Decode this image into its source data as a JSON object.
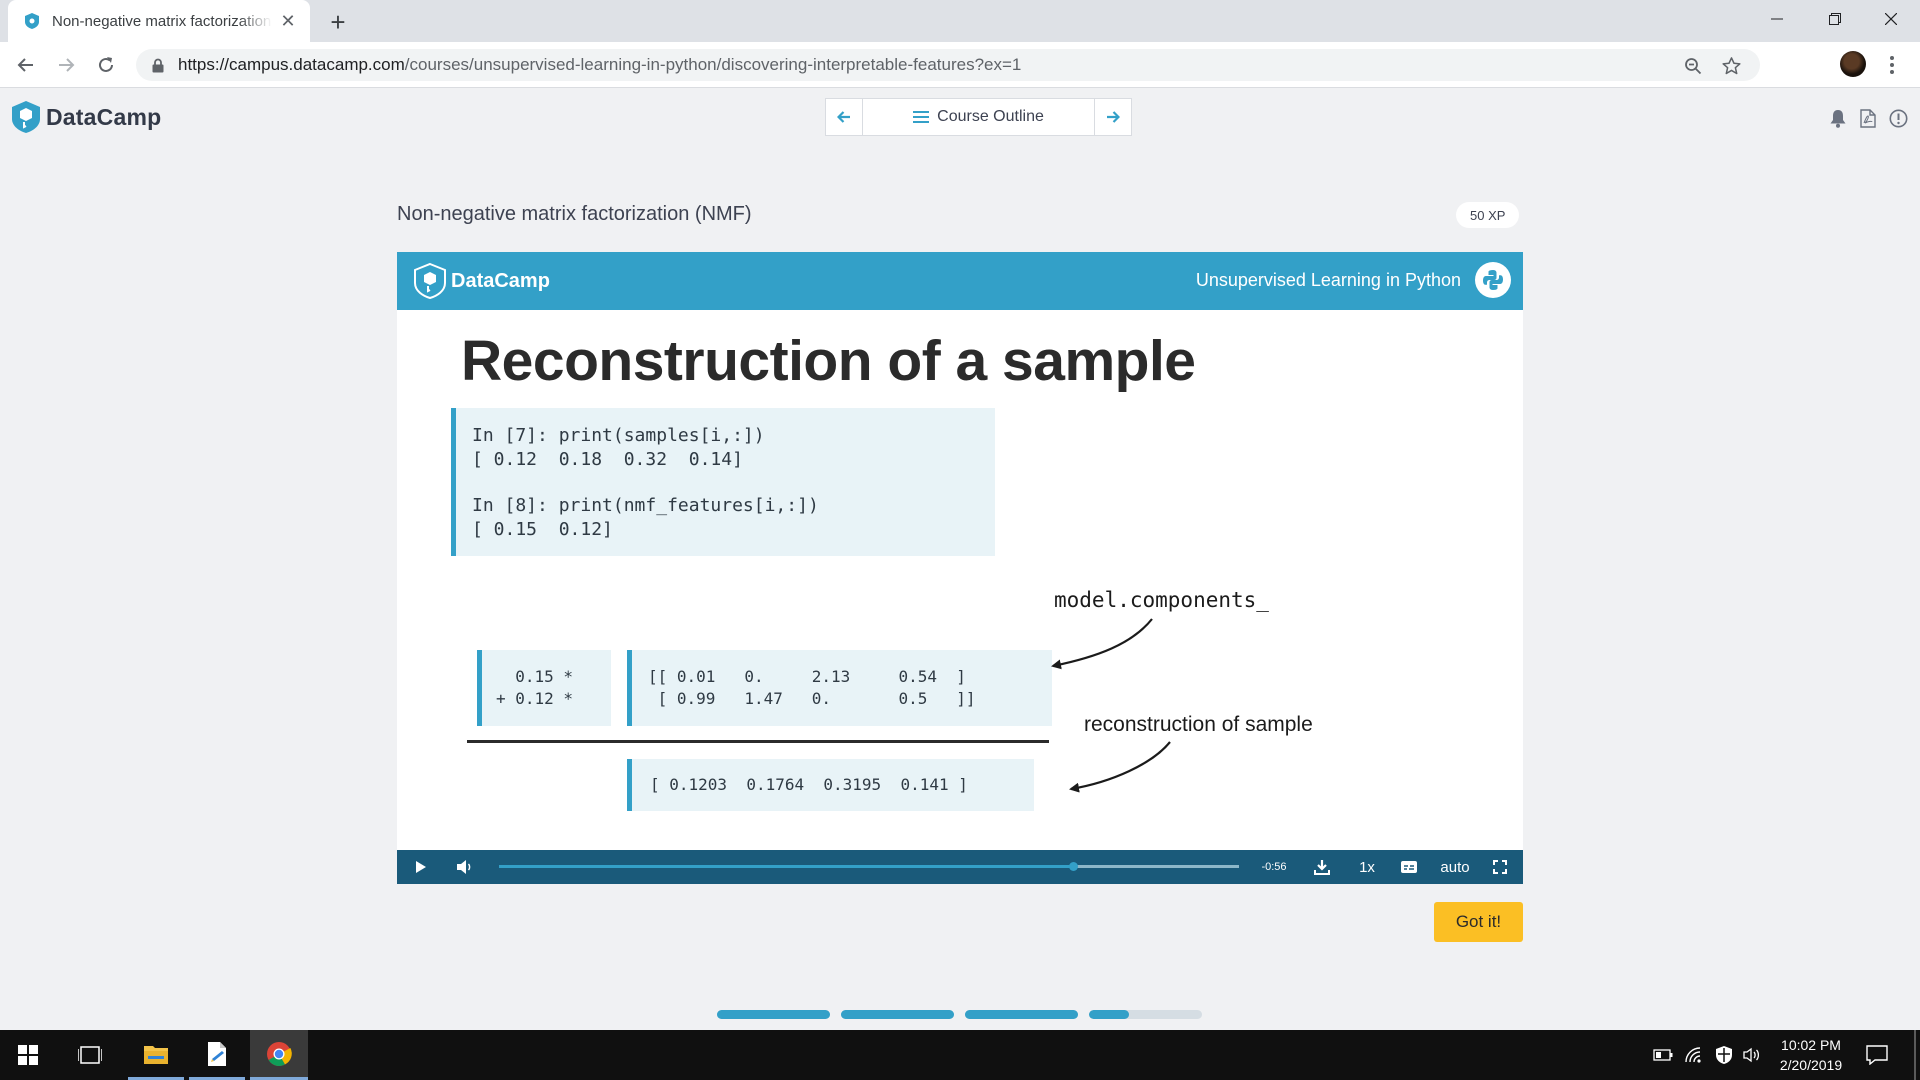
{
  "browser": {
    "tab_title": "Non-negative matrix factorization (NMF) | Python",
    "url_host": "https://campus.datacamp.com",
    "url_path": "/courses/unsupervised-learning-in-python/discovering-interpretable-features?ex=1"
  },
  "header": {
    "logo_text": "DataCamp",
    "course_outline_label": "Course Outline"
  },
  "exercise": {
    "title": "Non-negative matrix factorization (NMF)",
    "xp": "50 XP",
    "got_it_label": "Got it!"
  },
  "slide": {
    "logo_text": "DataCamp",
    "course_name": "Unsupervised Learning in Python",
    "heading": "Reconstruction of a sample",
    "code_lines": [
      "In [7]: print(samples[i,:])",
      "[ 0.12  0.18  0.32  0.14]",
      "In [8]: print(nmf_features[i,:])",
      "[ 0.15  0.12]"
    ],
    "coef_lines": [
      "  0.15 *",
      "+ 0.12 *"
    ],
    "matrix_lines": [
      "[[ 0.01   0.     2.13     0.54  ]",
      " [ 0.99   1.47   0.       0.5   ]]"
    ],
    "result_line": "[ 0.1203  0.1764  0.3195  0.141 ]",
    "label_components": "model.components_",
    "label_reconstruction": "reconstruction of sample"
  },
  "player": {
    "time_remaining": "-0:56",
    "speed": "1x",
    "quality": "auto",
    "progress_fraction": 0.776
  },
  "lesson_progress": [
    1,
    1,
    1,
    0.35
  ],
  "taskbar": {
    "time": "10:02 PM",
    "date": "2/20/2019"
  },
  "colors": {
    "brand_blue": "#33a0c8",
    "player_bar": "#1a5a7a",
    "got_it_yellow": "#fbbf24"
  }
}
